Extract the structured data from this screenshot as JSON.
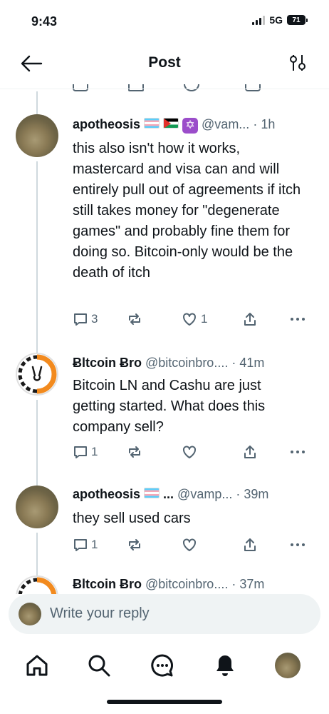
{
  "status_bar": {
    "time": "9:43",
    "network": "5G",
    "battery": "71"
  },
  "header": {
    "title": "Post",
    "back_icon": "arrow-left-icon",
    "filter_icon": "sliders-icon"
  },
  "posts": [
    {
      "name": "apotheosis",
      "handle": "@vam...",
      "separator": "·",
      "time": "1h",
      "text": "this also isn't how it works, mastercard and visa can and will entirely pull out of agreements if itch still takes money for \"degenerate games\" and probably fine them for doing so. Bitcoin-only would be the death of itch",
      "replies": "3",
      "reposts": "",
      "likes": "1"
    },
    {
      "name": "Ƀltcoin Ƀro",
      "handle": "@bitcoinbro....",
      "separator": "·",
      "time": "41m",
      "text": "Bitcoin LN and Cashu are just getting started. What does this company sell?",
      "replies": "1",
      "reposts": "",
      "likes": ""
    },
    {
      "name": "apotheosis",
      "name_suffix": "...",
      "handle": "@vamp...",
      "separator": "·",
      "time": "39m",
      "text": "they sell used cars",
      "replies": "1",
      "reposts": "",
      "likes": ""
    },
    {
      "name": "Ƀltcoin Ƀro",
      "handle": "@bitcoinbro....",
      "separator": "·",
      "time": "37m"
    }
  ],
  "composer": {
    "placeholder": "Write your reply"
  },
  "tabbar": {
    "items": [
      "home-icon",
      "search-icon",
      "messages-icon",
      "notifications-icon",
      "profile-avatar"
    ]
  },
  "colors": {
    "text": "#0f1419",
    "secondary": "#536471",
    "composer_bg": "#eff3f4"
  }
}
